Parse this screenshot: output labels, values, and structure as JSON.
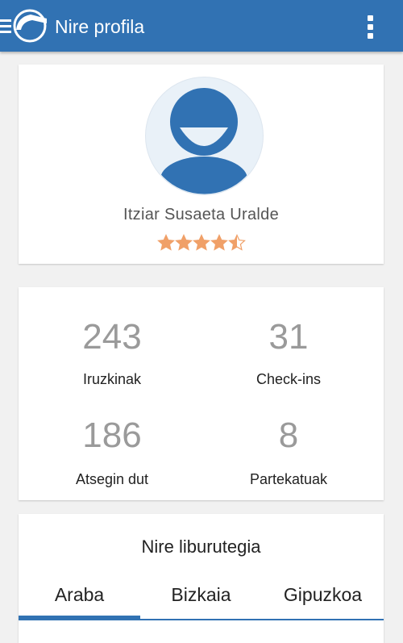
{
  "header": {
    "title": "Nire profila",
    "menu_icon": "hamburger-menu-icon",
    "logo_icon": "app-logo-icon",
    "overflow_icon": "more-vert-icon",
    "color": "#3172b3"
  },
  "profile": {
    "avatar_icon": "user-avatar-icon",
    "name": "Itziar Susaeta Uralde",
    "rating": 4.5,
    "rating_max": 5,
    "star_color": "#f0a068"
  },
  "stats": [
    {
      "value": "243",
      "label": "Iruzkinak"
    },
    {
      "value": "31",
      "label": "Check-ins"
    },
    {
      "value": "186",
      "label": "Atsegin dut"
    },
    {
      "value": "8",
      "label": "Partekatuak"
    }
  ],
  "library": {
    "title": "Nire liburutegia",
    "tabs": [
      {
        "label": "Araba",
        "active": true
      },
      {
        "label": "Bizkaia",
        "active": false
      },
      {
        "label": "Gipuzkoa",
        "active": false
      }
    ]
  }
}
